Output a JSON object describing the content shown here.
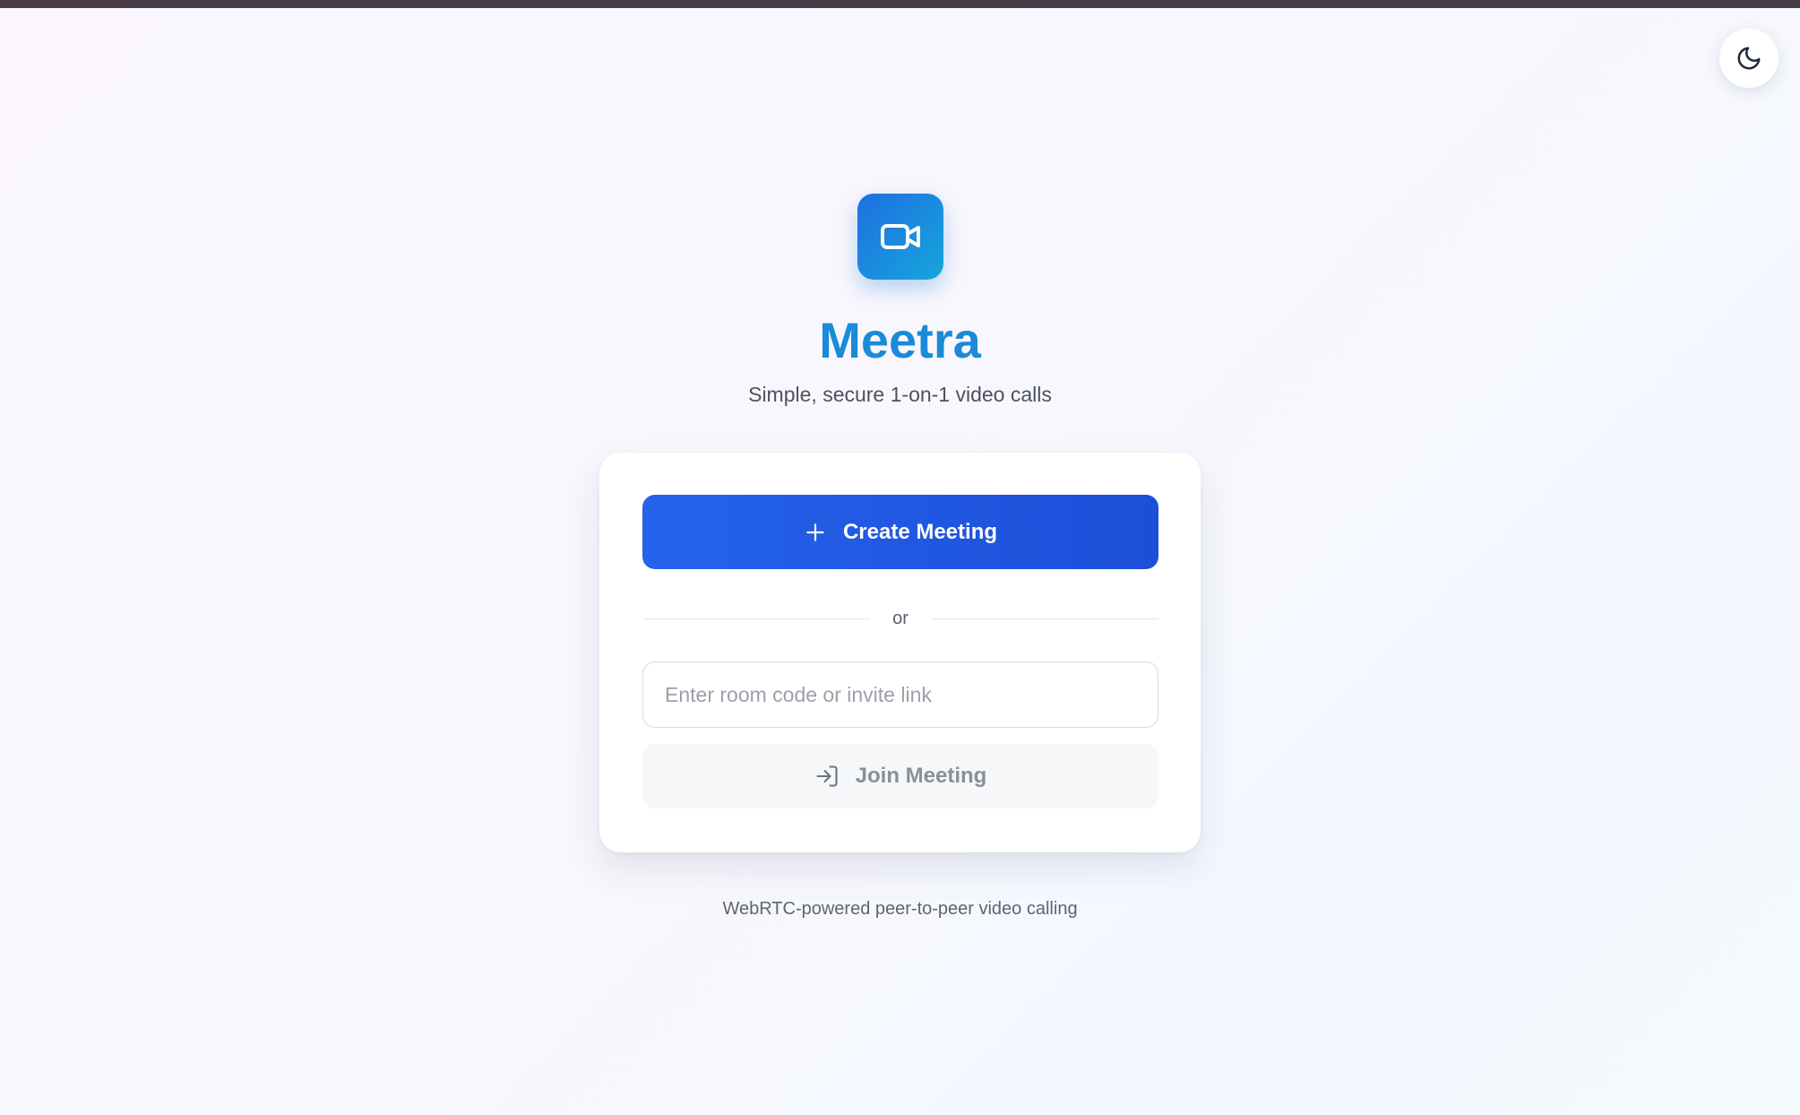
{
  "app": {
    "name": "Meetra",
    "tagline": "Simple, secure 1-on-1 video calls",
    "logo_icon": "video-camera-icon",
    "brand_color": "#1b8ad8"
  },
  "header": {
    "theme_toggle_icon": "moon-icon"
  },
  "card": {
    "create_button": {
      "label": "Create Meeting",
      "icon": "plus-icon",
      "color": "#2563eb"
    },
    "divider_text": "or",
    "room_input": {
      "placeholder": "Enter room code or invite link",
      "value": ""
    },
    "join_button": {
      "label": "Join Meeting",
      "icon": "log-in-icon"
    }
  },
  "footer": {
    "note": "WebRTC-powered peer-to-peer video calling"
  }
}
